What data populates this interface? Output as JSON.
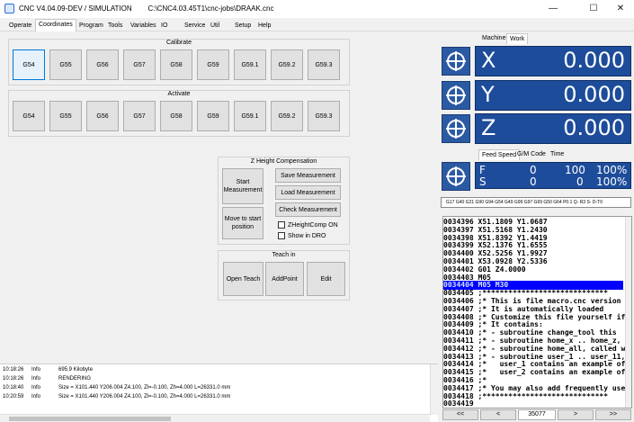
{
  "window": {
    "title": "CNC V4.04.09-DEV / SIMULATION        C:\\CNC4.03.45T1\\cnc-jobs\\DRAAK.cnc",
    "minimize": "—",
    "maximize": "☐",
    "close": "✕"
  },
  "menu": {
    "tabs": [
      "Operate",
      "Coordinates",
      "Program",
      "Tools",
      "Variables",
      "IO",
      "Service",
      "Util",
      "Setup",
      "Help"
    ]
  },
  "calibrate": {
    "title": "Calibrate",
    "buttons": [
      "G54",
      "G55",
      "G56",
      "G57",
      "G58",
      "G59",
      "G59.1",
      "G59.2",
      "G59.3"
    ]
  },
  "activate": {
    "title": "Activate",
    "buttons": [
      "G54",
      "G55",
      "G56",
      "G57",
      "G58",
      "G59",
      "G59.1",
      "G59.2",
      "G59.3"
    ]
  },
  "zheight": {
    "title": "Z Height Compensation",
    "start_measurement": "Start Measurement",
    "move_to_start": "Move to start position",
    "save_measurement": "Save Measurement",
    "load_measurement": "Load Measurement",
    "check_measurement": "Check Measurement",
    "zheightcomp_on": "ZHeightComp ON",
    "show_in_dro": "Show in DRO"
  },
  "teachin": {
    "title": "Teach in",
    "open_teach": "Open Teach",
    "add_point": "AddPoint",
    "edit": "Edit"
  },
  "log": {
    "rows": [
      {
        "time": "10:18:26",
        "level": "Info",
        "message": "695.9 Kilobyte"
      },
      {
        "time": "10:18:26",
        "level": "Info",
        "message": "RENDERING"
      },
      {
        "time": "10:18:40",
        "level": "Info",
        "message": "Size = X101.440 Y206.004 Z4.100, Zl=-0.100, Zh=4.000 L=26331.0 mm"
      },
      {
        "time": "10:20:59",
        "level": "Info",
        "message": "Size = X101.440 Y206.004 Z4.100, Zl=-0.100, Zh=4.000 L=26331.0 mm"
      }
    ]
  },
  "dro": {
    "tabs": [
      "Machine",
      "Work"
    ],
    "active_tab": "Work",
    "axes": [
      {
        "letter": "X",
        "value": "0.000"
      },
      {
        "letter": "Y",
        "value": "0.000"
      },
      {
        "letter": "Z",
        "value": "0.000"
      }
    ],
    "feed_tabs": [
      "Feed Speed",
      "G/M Code",
      "Time"
    ],
    "feed": {
      "label": "F",
      "value": "0",
      "override": "100",
      "percent": "100%"
    },
    "speed": {
      "label": "S",
      "value": "0",
      "override": "0",
      "percent": "100%"
    },
    "gm_codes": "G17 G40 G21 G90 G94 G54 G49 G99 G97 G69 G50 G64 P0.1 Q- R3 S- D-T0"
  },
  "program": {
    "lines": [
      "0034396 X51.1809 Y1.0687",
      "0034397 X51.5168 Y1.2430",
      "0034398 X51.8392 Y1.4419",
      "0034399 X52.1376 Y1.6555",
      "0034400 X52.5256 Y1.9927",
      "0034401 X53.0928 Y2.5336",
      "0034402 G01 Z4.0000",
      "0034403 M05",
      "0034404 M05 M30",
      "0034405 ;*****************************",
      "0034406 ;* This is file macro.cnc version",
      "0034407 ;* It is automatically loaded",
      "0034408 ;* Customize this file yourself if",
      "0034409 ;* It contains:",
      "0034410 ;* - subroutine change_tool this",
      "0034411 ;* - subroutine home_x .. home_z,",
      "0034412 ;* - subroutine home_all, called w",
      "0034413 ;* - subroutine user_1 .. user_11,",
      "0034414 ;*   user_1 contains an example of",
      "0034415 ;*   user_2 contains an example of",
      "0034416 ;*",
      "0034417 ;* You may also add frequently use",
      "0034418 ;*****************************",
      "0034419"
    ],
    "highlight_index": 8,
    "nav": [
      "<<",
      "<",
      "35077",
      ">",
      ">>"
    ]
  },
  "colors": {
    "dro_blue": "#1d4c9a",
    "highlight": "#0000ff"
  }
}
